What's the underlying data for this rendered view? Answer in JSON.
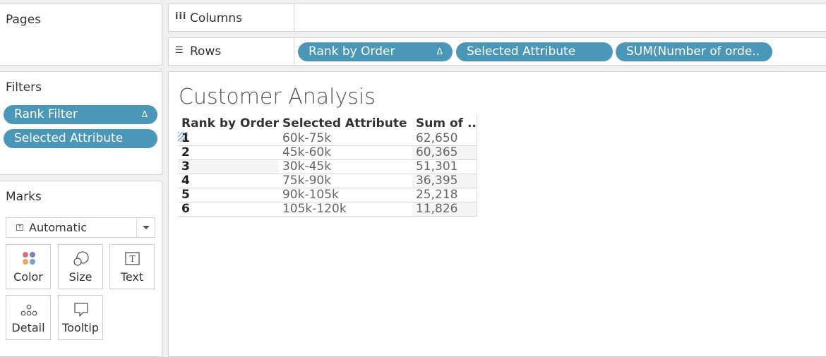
{
  "pages": {
    "title": "Pages"
  },
  "columns_shelf": {
    "label": "Columns"
  },
  "rows_shelf": {
    "label": "Rows",
    "pills": [
      {
        "label": "Rank by Order",
        "delta": "Δ"
      },
      {
        "label": "Selected Attribute"
      },
      {
        "label": "SUM(Number of orde.."
      }
    ]
  },
  "filters": {
    "title": "Filters",
    "pills": [
      {
        "label": "Rank Filter",
        "delta": "Δ"
      },
      {
        "label": "Selected Attribute"
      }
    ]
  },
  "marks": {
    "title": "Marks",
    "mark_type": "Automatic",
    "buttons": [
      {
        "label": "Color",
        "icon": "color-icon"
      },
      {
        "label": "Size",
        "icon": "size-icon"
      },
      {
        "label": "Text",
        "icon": "text-icon"
      },
      {
        "label": "Detail",
        "icon": "detail-icon"
      },
      {
        "label": "Tooltip",
        "icon": "tooltip-icon"
      }
    ]
  },
  "view": {
    "title": "Customer Analysis",
    "headers": [
      "Rank by Order",
      "Selected Attribute",
      "Sum of .."
    ],
    "rows": [
      {
        "rank": "1",
        "attribute": "60k-75k",
        "sum": "62,650"
      },
      {
        "rank": "2",
        "attribute": "45k-60k",
        "sum": "60,365"
      },
      {
        "rank": "3",
        "attribute": "30k-45k",
        "sum": "51,301"
      },
      {
        "rank": "4",
        "attribute": "75k-90k",
        "sum": "36,395"
      },
      {
        "rank": "5",
        "attribute": "90k-105k",
        "sum": "25,218"
      },
      {
        "rank": "6",
        "attribute": "105k-120k",
        "sum": "11,826"
      }
    ]
  },
  "colors": {
    "pill": "#4a97b8",
    "panel_border": "#d4d4d4",
    "background": "#f0f0f0"
  }
}
